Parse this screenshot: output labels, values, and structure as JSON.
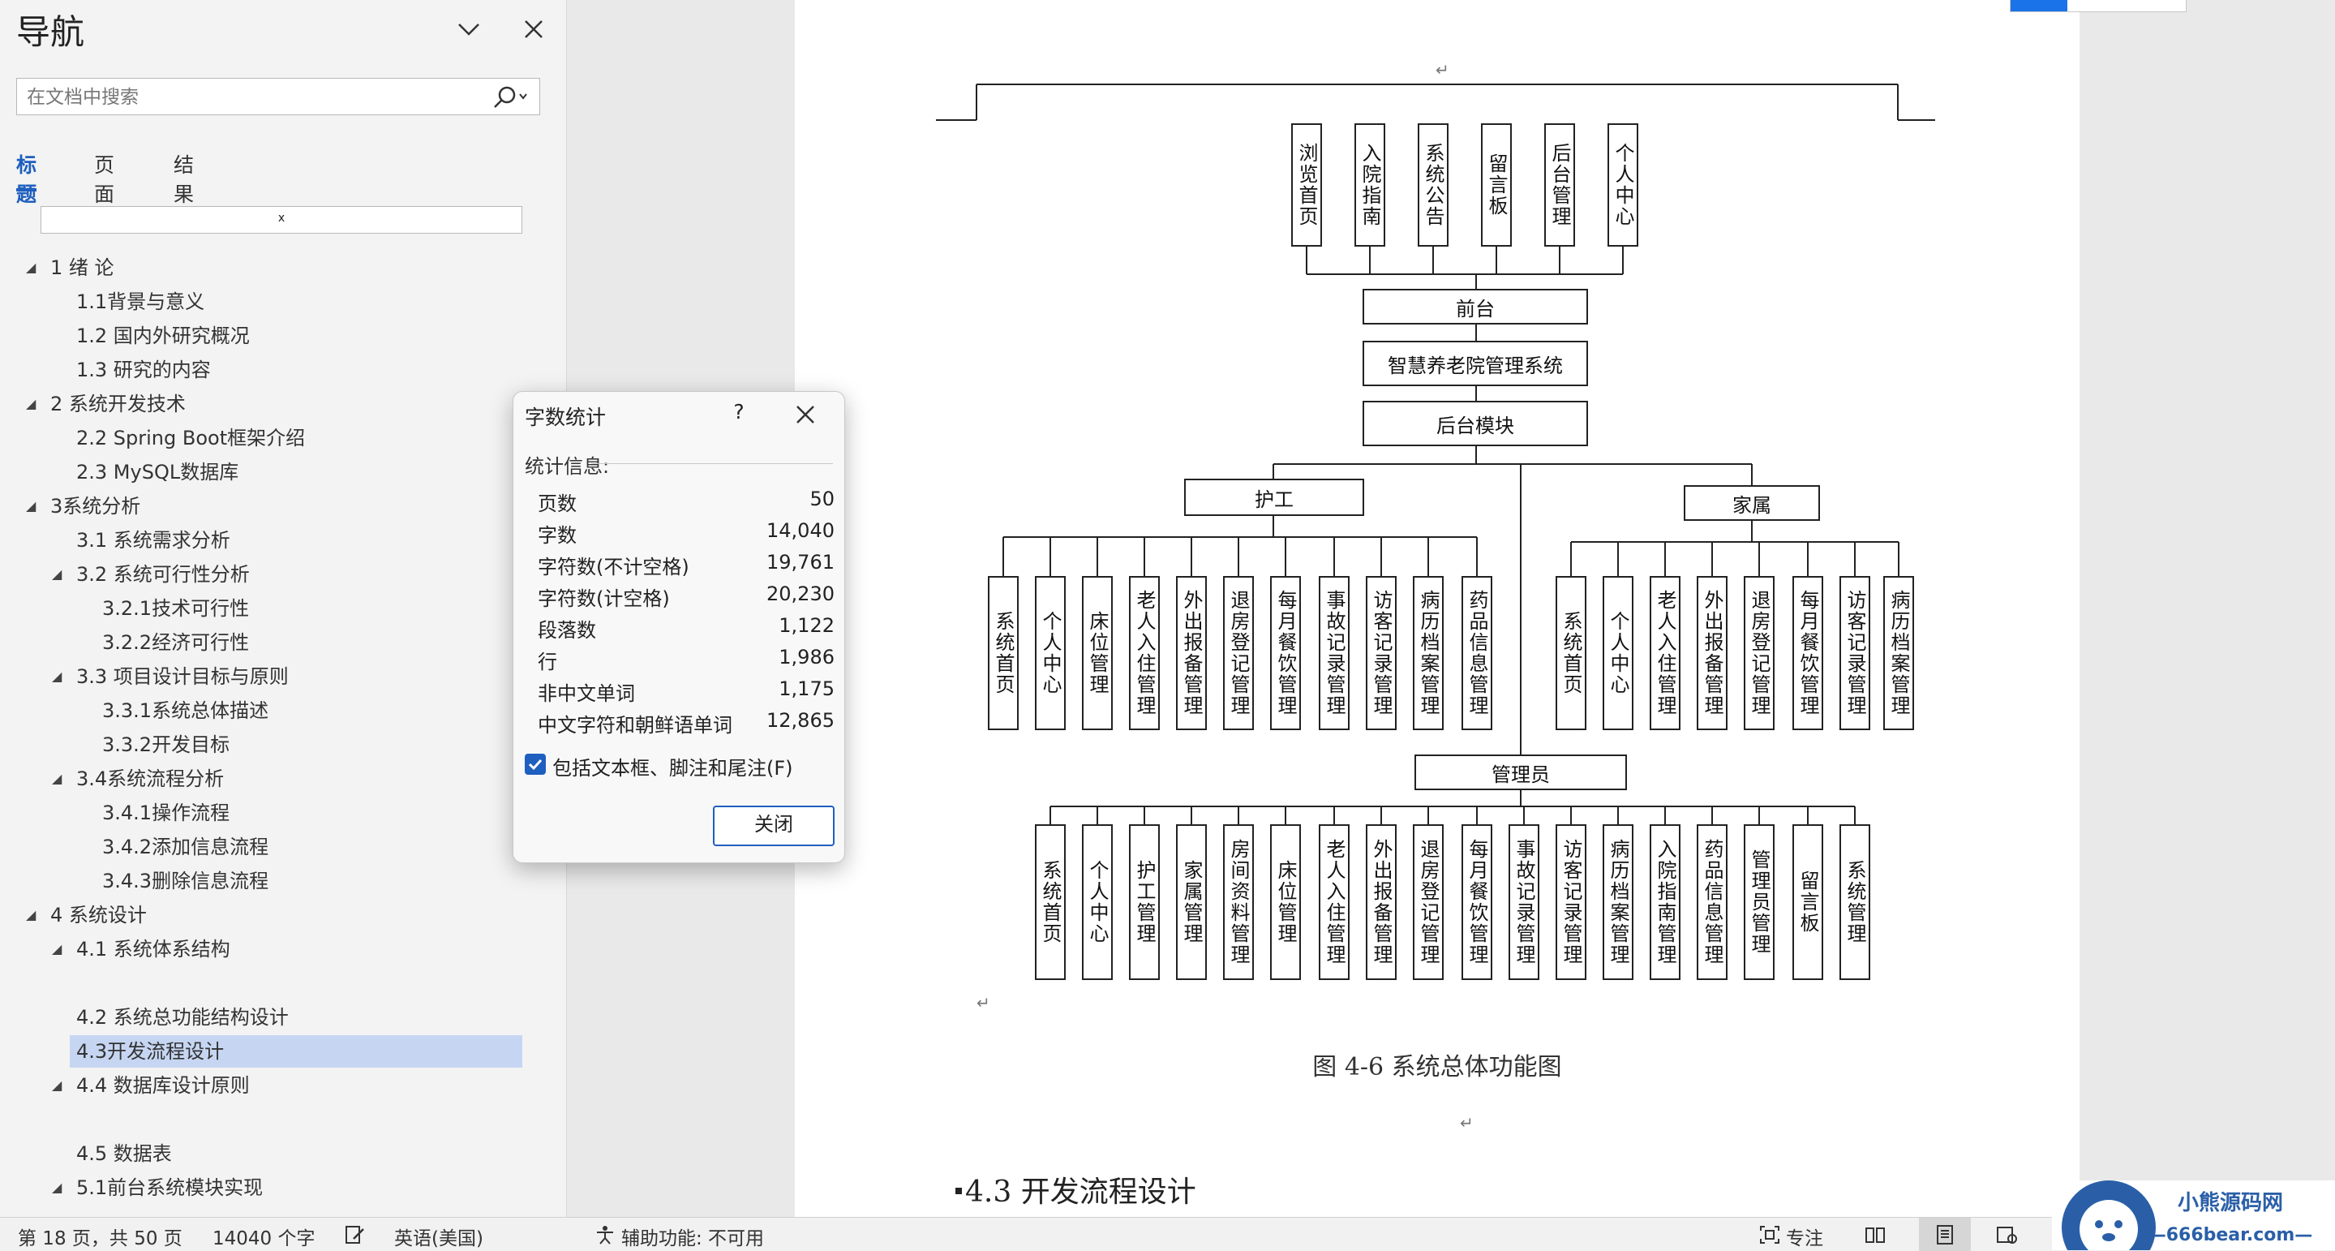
{
  "nav": {
    "title": "导航",
    "search_placeholder": "在文档中搜索",
    "tabs": [
      "标题",
      "页面",
      "结果"
    ],
    "filter_text": "x",
    "outline": [
      {
        "label": "1 绪  论",
        "level": 1
      },
      {
        "label": "1.1背景与意义",
        "level": 2
      },
      {
        "label": "1.2 国内外研究概况",
        "level": 2
      },
      {
        "label": "1.3 研究的内容",
        "level": 2
      },
      {
        "label": "2 系统开发技术",
        "level": 1
      },
      {
        "label": "2.2 Spring Boot框架介绍",
        "level": 2
      },
      {
        "label": "2.3 MySQL数据库",
        "level": 2
      },
      {
        "label": "3系统分析",
        "level": 1
      },
      {
        "label": "3.1 系统需求分析",
        "level": 2
      },
      {
        "label": "3.2 系统可行性分析",
        "level": 2
      },
      {
        "label": "3.2.1技术可行性",
        "level": 3
      },
      {
        "label": "3.2.2经济可行性",
        "level": 3
      },
      {
        "label": "3.3 项目设计目标与原则",
        "level": 2
      },
      {
        "label": "3.3.1系统总体描述",
        "level": 3
      },
      {
        "label": "3.3.2开发目标",
        "level": 3
      },
      {
        "label": "3.4系统流程分析",
        "level": 2
      },
      {
        "label": "3.4.1操作流程",
        "level": 3
      },
      {
        "label": "3.4.2添加信息流程",
        "level": 3
      },
      {
        "label": "3.4.3删除信息流程",
        "level": 3
      },
      {
        "label": "4 系统设计",
        "level": 1
      },
      {
        "label": "4.1 系统体系结构",
        "level": 2
      },
      {
        "label": "4.2 系统总功能结构设计",
        "level": 2
      },
      {
        "label": "4.3开发流程设计",
        "level": 2,
        "selected": true
      },
      {
        "label": "4.4 数据库设计原则",
        "level": 2
      },
      {
        "label": "4.5 数据表",
        "level": 2
      },
      {
        "label": "5.1前台系统模块实现",
        "level": 2
      }
    ]
  },
  "dialog": {
    "title": "字数统计",
    "help": "?",
    "stats_label": "统计信息:",
    "stats": [
      {
        "label": "页数",
        "value": "50"
      },
      {
        "label": "字数",
        "value": "14,040"
      },
      {
        "label": "字符数(不计空格)",
        "value": "19,761"
      },
      {
        "label": "字符数(计空格)",
        "value": "20,230"
      },
      {
        "label": "段落数",
        "value": "1,122"
      },
      {
        "label": "行",
        "value": "1,986"
      },
      {
        "label": "非中文单词",
        "value": "1,175"
      },
      {
        "label": "中文字符和朝鲜语单词",
        "value": "12,865"
      }
    ],
    "include_label": "包括文本框、脚注和尾注(F)",
    "include_checked": true,
    "close_button": "关闭"
  },
  "doc": {
    "diagram": {
      "front_children": [
        "浏览首页",
        "入院指南",
        "系统公告",
        "留言板",
        "后台管理",
        "个人中心"
      ],
      "front": "前台",
      "root": "智慧养老院管理系统",
      "backend": "后台模块",
      "nurse": "护工",
      "nurse_children": [
        "系统首页",
        "个人中心",
        "床位管理",
        "老人入住管理",
        "外出报备管理",
        "退房登记管理",
        "每月餐饮管理",
        "事故记录管理",
        "访客记录管理",
        "病历档案管理",
        "药品信息管理"
      ],
      "family": "家属",
      "family_children": [
        "系统首页",
        "个人中心",
        "老人入住管理",
        "外出报备管理",
        "退房登记管理",
        "每月餐饮管理",
        "访客记录管理",
        "病历档案管理"
      ],
      "admin": "管理员",
      "admin_children": [
        "系统首页",
        "个人中心",
        "护工管理",
        "家属管理",
        "房间资料管理",
        "床位管理",
        "老人入住管理",
        "外出报备管理",
        "退房登记管理",
        "每月餐饮管理",
        "事故记录管理",
        "访客记录管理",
        "病历档案管理",
        "入院指南管理",
        "药品信息管理",
        "管理员管理",
        "留言板",
        "系统管理"
      ]
    },
    "caption": "图 4-6  系统总体功能图",
    "section_heading": "4.3 开发流程设计",
    "para_mark": "↵"
  },
  "status_bar": {
    "page": "第 18 页，共 50 页",
    "words": "14040 个字",
    "language": "英语(美国)",
    "accessibility": "辅助功能: 不可用",
    "focus": "专注"
  },
  "watermark": {
    "name": "小熊源码网",
    "url": "—666bear.com—"
  }
}
